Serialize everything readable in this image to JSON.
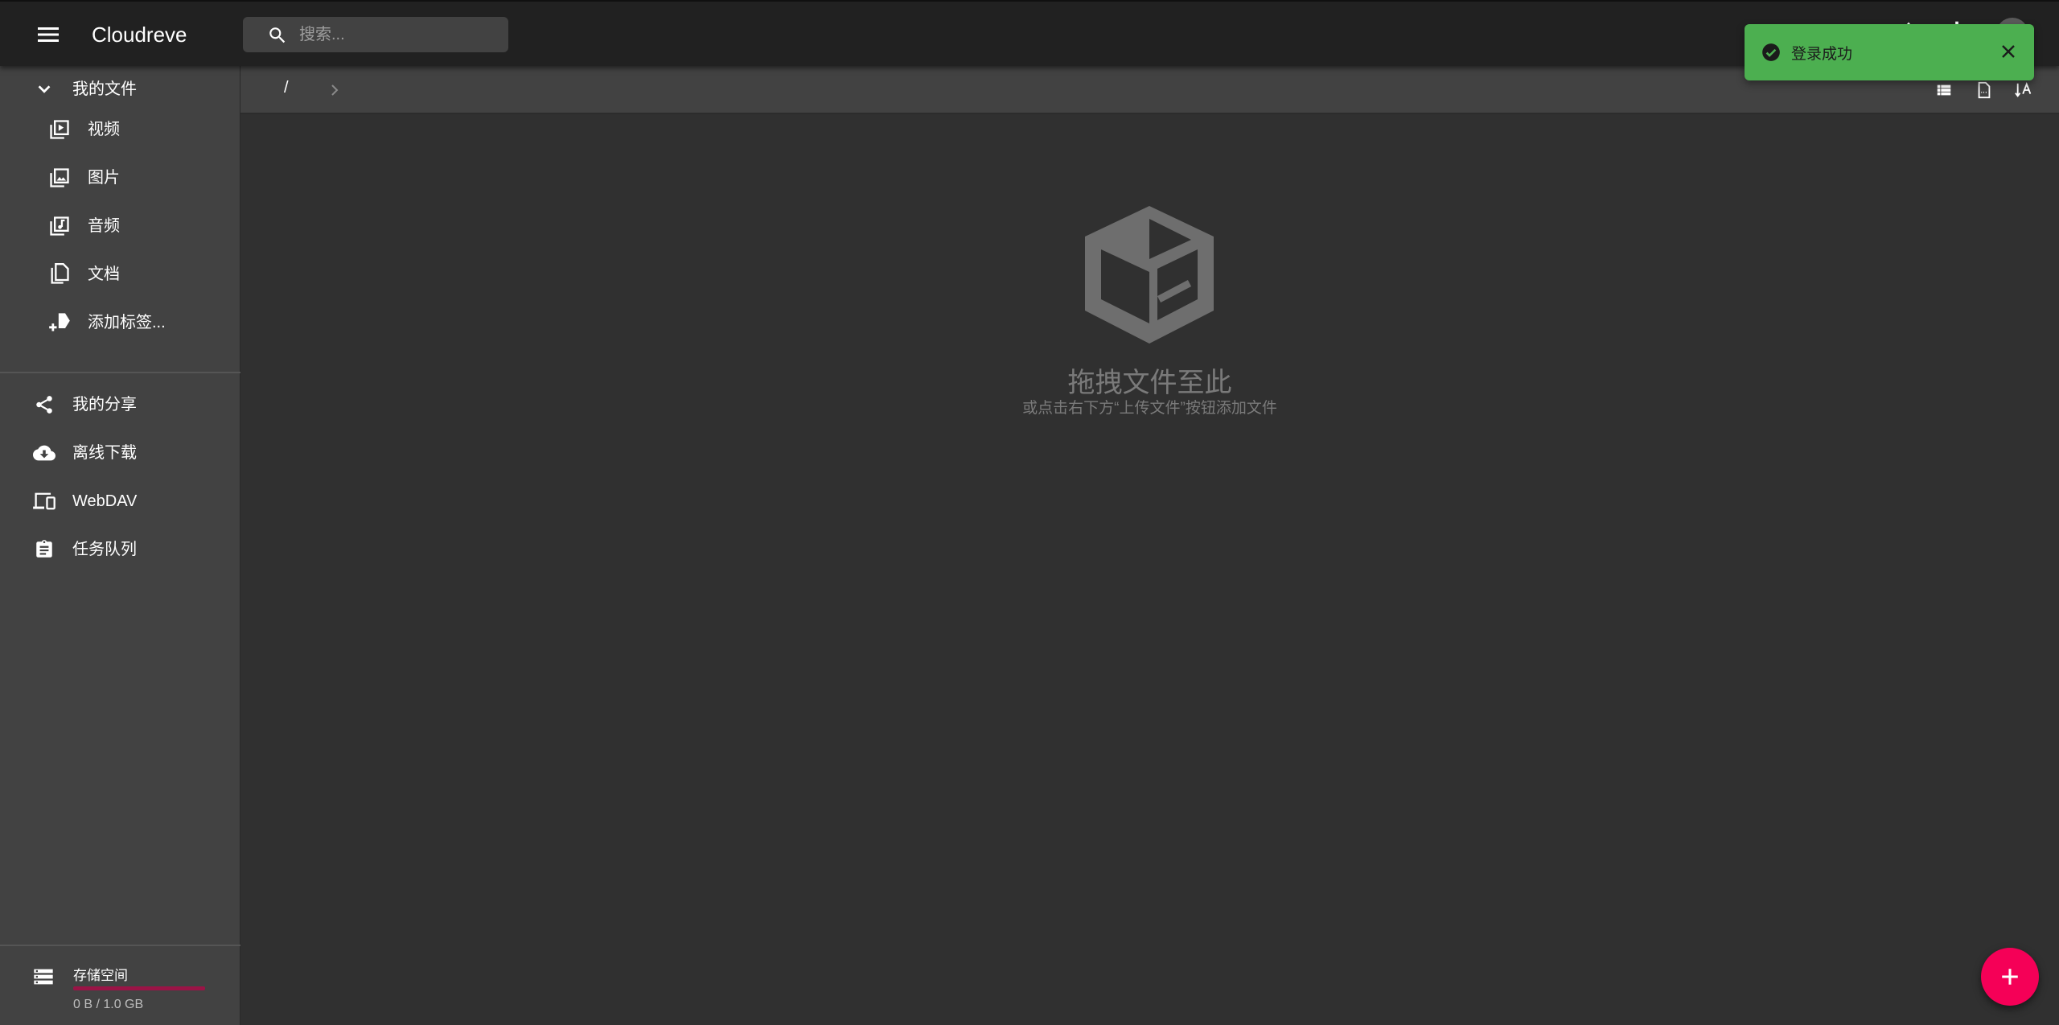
{
  "app": {
    "title": "Cloudreve"
  },
  "search": {
    "placeholder": "搜索..."
  },
  "sidebar": {
    "my_files": {
      "label": "我的文件",
      "icon": "chevron-down-icon"
    },
    "file_types": [
      {
        "label": "视频",
        "icon": "video-library-icon"
      },
      {
        "label": "图片",
        "icon": "photo-library-icon"
      },
      {
        "label": "音频",
        "icon": "music-library-icon"
      },
      {
        "label": "文档",
        "icon": "file-copy-icon"
      },
      {
        "label": "添加标签...",
        "icon": "add-tag-icon"
      }
    ],
    "items": [
      {
        "label": "我的分享",
        "icon": "share-icon"
      },
      {
        "label": "离线下载",
        "icon": "cloud-download-icon"
      },
      {
        "label": "WebDAV",
        "icon": "devices-icon"
      },
      {
        "label": "任务队列",
        "icon": "assignment-icon"
      }
    ],
    "storage": {
      "title": "存储空间",
      "usage": "0 B / 1.0 GB",
      "used_fraction": 0,
      "icon": "storage-icon"
    }
  },
  "breadcrumb": {
    "root": "/"
  },
  "empty_state": {
    "headline": "拖拽文件至此",
    "hint": "或点击右下方“上传文件”按钮添加文件"
  },
  "toast": {
    "message": "登录成功",
    "color": "#4caf50"
  },
  "colors": {
    "accent": "#f50057",
    "appbar": "#212121",
    "panel": "#424242",
    "background": "#303030"
  }
}
